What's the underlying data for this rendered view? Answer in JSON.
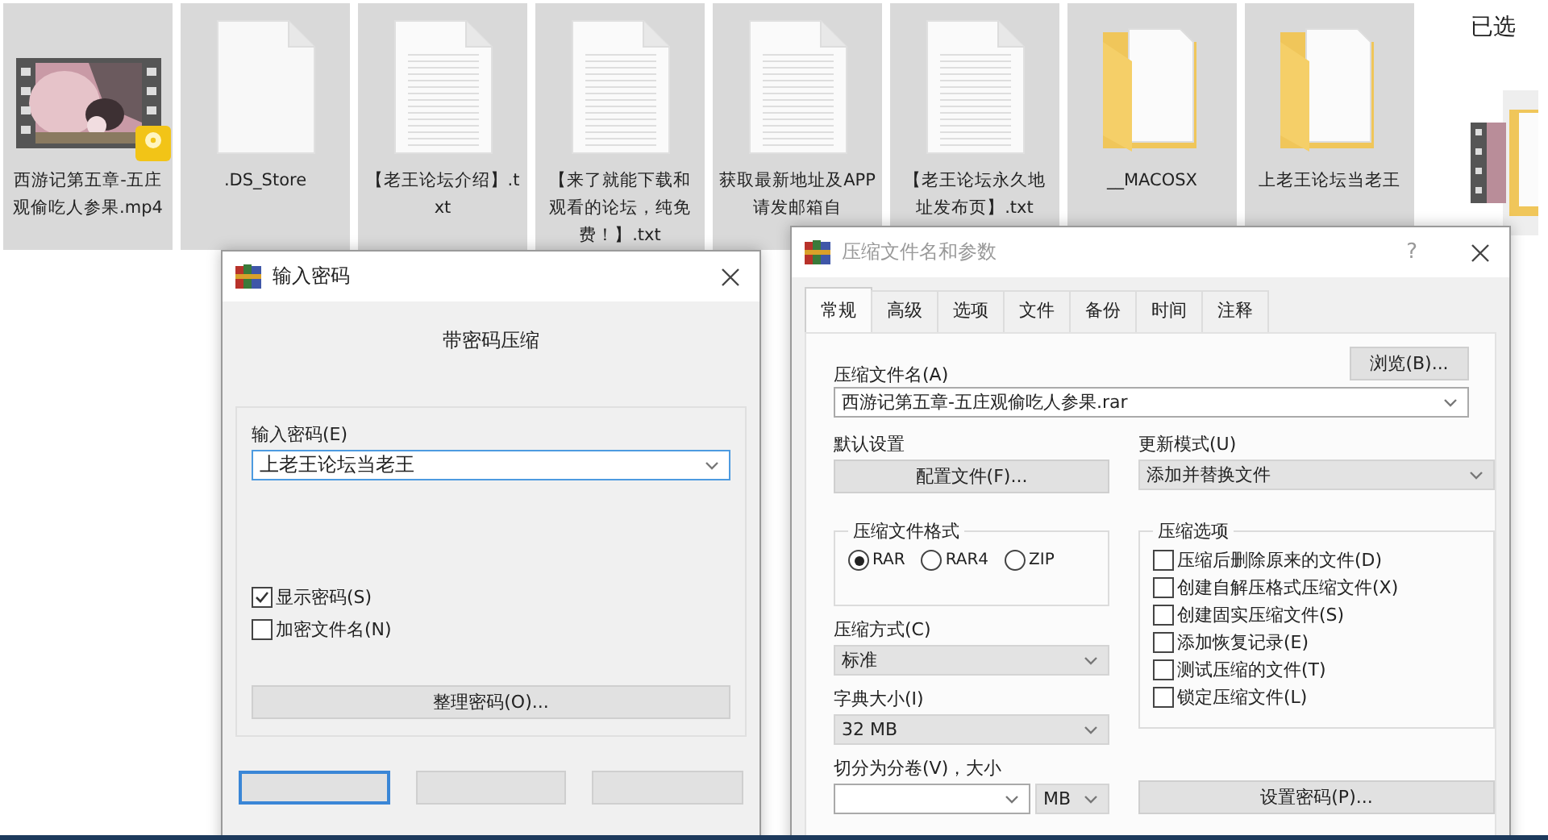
{
  "desktop": {
    "files": [
      {
        "name": "西游记第五章-五庄观偷吃人参果.mp4",
        "kind": "video",
        "selected": true
      },
      {
        "name": ".DS_Store",
        "kind": "blank",
        "selected": true
      },
      {
        "name": "【老王论坛介绍】.txt",
        "kind": "text",
        "selected": true
      },
      {
        "name": "【来了就能下载和观看的论坛，纯免费！】.txt",
        "kind": "text",
        "selected": true
      },
      {
        "name": "获取最新地址及APP请发邮箱自",
        "kind": "text",
        "selected": true
      },
      {
        "name": "【老王论坛永久地址发布页】.txt",
        "kind": "text",
        "selected": true
      },
      {
        "name": "__MACOSX",
        "kind": "folder",
        "selected": true
      },
      {
        "name": "上老王论坛当老王",
        "kind": "folder",
        "selected": true
      }
    ],
    "details_title": "已选"
  },
  "password_dialog": {
    "title": "输入密码",
    "heading": "带密码压缩",
    "password_label": "输入密码(E)",
    "password_value": "上老王论坛当老王",
    "options": [
      {
        "label": "显示密码(S)",
        "checked": true
      },
      {
        "label": "加密文件名(N)",
        "checked": false
      }
    ],
    "organize_button": "整理密码(O)..."
  },
  "archive_dialog": {
    "title": "压缩文件名和参数",
    "help": "?",
    "tabs": [
      {
        "label": "常规",
        "selected": true
      },
      {
        "label": "高级",
        "selected": false
      },
      {
        "label": "选项",
        "selected": false
      },
      {
        "label": "文件",
        "selected": false
      },
      {
        "label": "备份",
        "selected": false
      },
      {
        "label": "时间",
        "selected": false
      },
      {
        "label": "注释",
        "selected": false
      }
    ],
    "archive_name_label": "压缩文件名(A)",
    "browse_button": "浏览(B)...",
    "archive_name": "西游记第五章-五庄观偷吃人参果.rar",
    "profiles_label": "默认设置",
    "profiles_button": "配置文件(F)...",
    "update_mode_label": "更新模式(U)",
    "update_mode": "添加并替换文件",
    "format_group": "压缩文件格式",
    "formats": [
      {
        "label": "RAR",
        "selected": true
      },
      {
        "label": "RAR4",
        "selected": false
      },
      {
        "label": "ZIP",
        "selected": false
      }
    ],
    "method_label": "压缩方式(C)",
    "method": "标准",
    "dict_label": "字典大小(I)",
    "dict": "32 MB",
    "split_label": "切分为分卷(V)，大小",
    "split_unit": "MB",
    "options_group": "压缩选项",
    "options": [
      {
        "label": "压缩后删除原来的文件(D)",
        "checked": false
      },
      {
        "label": "创建自解压格式压缩文件(X)",
        "checked": false
      },
      {
        "label": "创建固实压缩文件(S)",
        "checked": false
      },
      {
        "label": "添加恢复记录(E)",
        "checked": false
      },
      {
        "label": "测试压缩的文件(T)",
        "checked": false
      },
      {
        "label": "锁定压缩文件(L)",
        "checked": false
      }
    ],
    "password_button": "设置密码(P)..."
  }
}
